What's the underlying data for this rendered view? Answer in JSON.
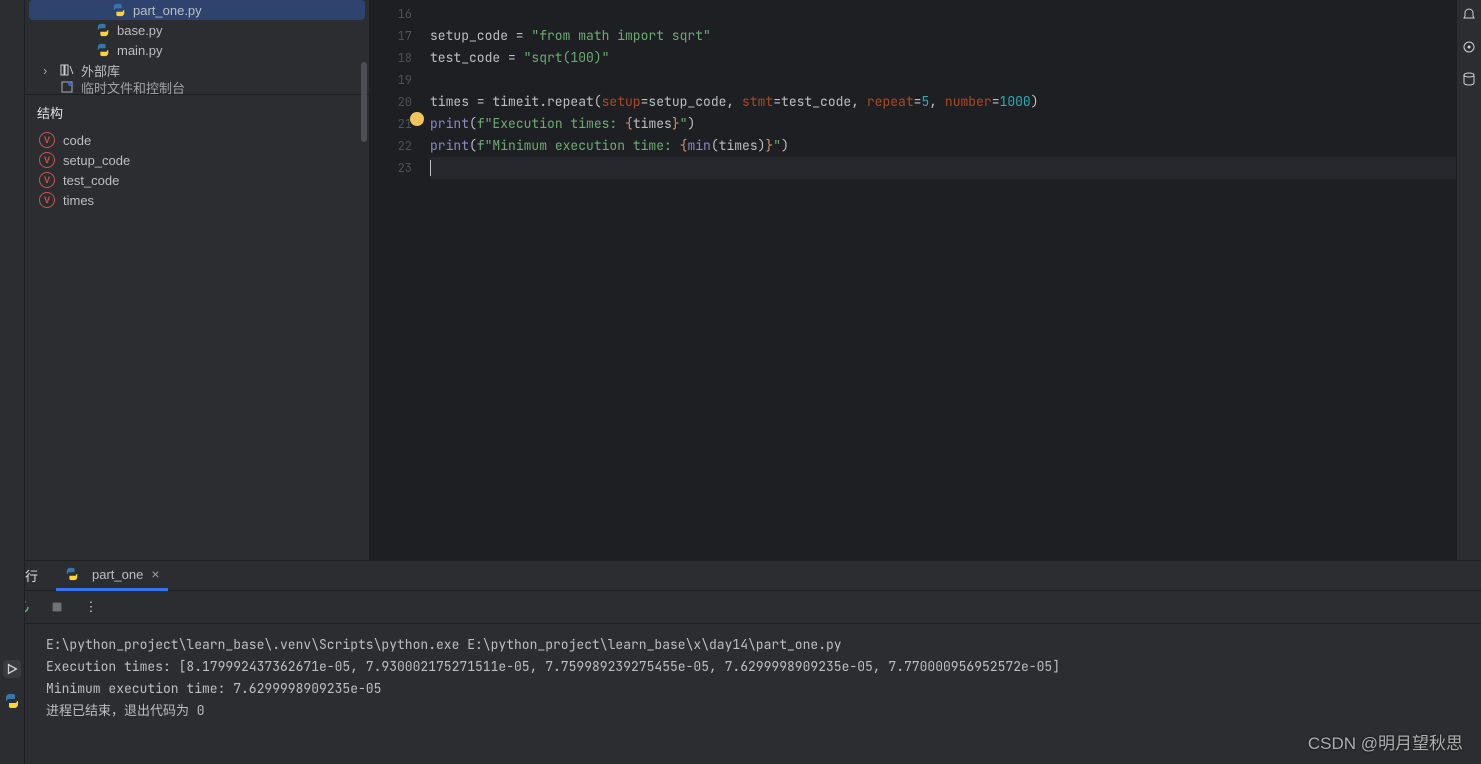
{
  "sidebar": {
    "files": [
      {
        "name": "part_one.py",
        "indent": 80,
        "selected": true,
        "icon": "py"
      },
      {
        "name": "base.py",
        "indent": 64,
        "selected": false,
        "icon": "py"
      },
      {
        "name": "main.py",
        "indent": 64,
        "selected": false,
        "icon": "py"
      }
    ],
    "external_libs": "外部库",
    "scratches_cut": "临时文件和控制台",
    "structure_header": "结构",
    "structure": [
      {
        "name": "code"
      },
      {
        "name": "setup_code"
      },
      {
        "name": "test_code"
      },
      {
        "name": "times"
      }
    ]
  },
  "editor": {
    "line_start": 16,
    "lines": [
      {
        "n": 16,
        "tokens": []
      },
      {
        "n": 17,
        "tokens": [
          {
            "t": "plain",
            "v": "setup_code = "
          },
          {
            "t": "str",
            "v": "\"from math import sqrt\""
          }
        ]
      },
      {
        "n": 18,
        "tokens": [
          {
            "t": "plain",
            "v": "test_code = "
          },
          {
            "t": "str",
            "v": "\"sqrt(100)\""
          }
        ]
      },
      {
        "n": 19,
        "tokens": []
      },
      {
        "n": 20,
        "tokens": [
          {
            "t": "plain",
            "v": "times = timeit.repeat("
          },
          {
            "t": "param",
            "v": "setup"
          },
          {
            "t": "plain",
            "v": "=setup_code, "
          },
          {
            "t": "param",
            "v": "stmt"
          },
          {
            "t": "plain",
            "v": "=test_code, "
          },
          {
            "t": "param",
            "v": "repeat"
          },
          {
            "t": "plain",
            "v": "="
          },
          {
            "t": "num",
            "v": "5"
          },
          {
            "t": "plain",
            "v": ", "
          },
          {
            "t": "param",
            "v": "number"
          },
          {
            "t": "plain",
            "v": "="
          },
          {
            "t": "num",
            "v": "1000"
          },
          {
            "t": "plain",
            "v": ")"
          }
        ]
      },
      {
        "n": 21,
        "tokens": [
          {
            "t": "builtin",
            "v": "print"
          },
          {
            "t": "plain",
            "v": "("
          },
          {
            "t": "str",
            "v": "f\"Execution times: "
          },
          {
            "t": "kw",
            "v": "{"
          },
          {
            "t": "plain",
            "v": "times"
          },
          {
            "t": "kw",
            "v": "}"
          },
          {
            "t": "str",
            "v": "\""
          },
          {
            "t": "plain",
            "v": ")"
          }
        ]
      },
      {
        "n": 22,
        "tokens": [
          {
            "t": "builtin",
            "v": "print"
          },
          {
            "t": "plain",
            "v": "("
          },
          {
            "t": "str",
            "v": "f\"Minimum execution time: "
          },
          {
            "t": "kw",
            "v": "{"
          },
          {
            "t": "builtin",
            "v": "min"
          },
          {
            "t": "plain",
            "v": "(times)"
          },
          {
            "t": "kw",
            "v": "}"
          },
          {
            "t": "str",
            "v": "\""
          },
          {
            "t": "plain",
            "v": ")"
          }
        ]
      },
      {
        "n": 23,
        "tokens": [],
        "current": true
      }
    ]
  },
  "run": {
    "label": "运行",
    "tab_name": "part_one",
    "console": [
      "E:\\python_project\\learn_base\\.venv\\Scripts\\python.exe E:\\python_project\\learn_base\\x\\day14\\part_one.py ",
      "Execution times: [8.179992437362671e-05, 7.930002175271511e-05, 7.759989239275455e-05, 7.6299998909235e-05, 7.770000956952572e-05]",
      "Minimum execution time: 7.6299998909235e-05",
      "",
      "进程已结束，退出代码为 0"
    ]
  },
  "watermark": "CSDN @明月望秋思"
}
